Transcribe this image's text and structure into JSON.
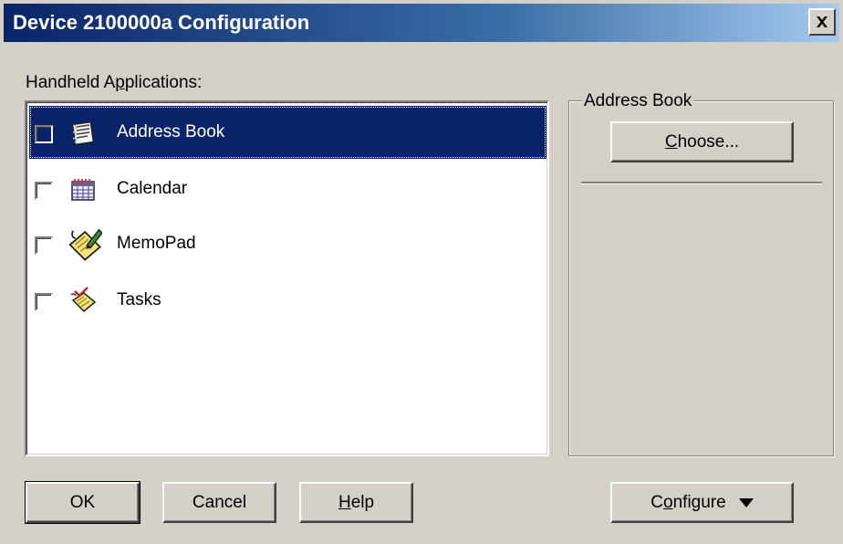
{
  "window": {
    "title": "Device  2100000a Configuration"
  },
  "apps": {
    "label_prefix": "Handheld A",
    "label_accel": "p",
    "label_suffix": "plications:",
    "items": [
      {
        "label": "Address Book",
        "icon": "address-book-icon",
        "checked": false,
        "selected": true
      },
      {
        "label": "Calendar",
        "icon": "calendar-icon",
        "checked": false,
        "selected": false
      },
      {
        "label": "MemoPad",
        "icon": "memopad-icon",
        "checked": false,
        "selected": false
      },
      {
        "label": "Tasks",
        "icon": "tasks-icon",
        "checked": false,
        "selected": false
      }
    ]
  },
  "group": {
    "title": "Address Book",
    "choose_accel": "C",
    "choose_rest": "hoose..."
  },
  "buttons": {
    "ok": "OK",
    "cancel": "Cancel",
    "help_accel": "H",
    "help_rest": "elp",
    "configure_prefix": "C",
    "configure_accel": "o",
    "configure_rest": "nfigure"
  },
  "colors": {
    "title_start": "#0a246a",
    "title_end": "#a6caf0",
    "selection": "#0a246a",
    "face": "#d4d0c8"
  }
}
